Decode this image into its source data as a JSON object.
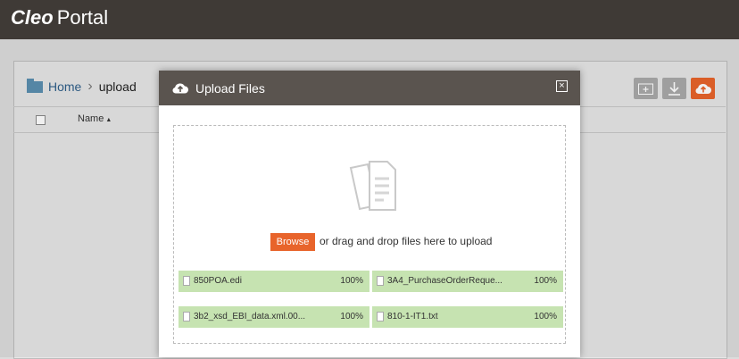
{
  "app": {
    "brand": "Cleo",
    "product": "Portal"
  },
  "breadcrumb": {
    "home": "Home",
    "current": "upload"
  },
  "table": {
    "name_header": "Name"
  },
  "toolbar": {
    "new_folder_icon": "folder-plus-icon",
    "download_icon": "download-icon",
    "upload_icon": "cloud-upload-icon",
    "upload_color": "#e8642b"
  },
  "modal": {
    "title": "Upload Files",
    "close_icon": "close-icon",
    "browse_label": "Browse",
    "drop_text": "or drag and drop files here to upload",
    "files": [
      {
        "name": "850POA.edi",
        "progress": "100%"
      },
      {
        "name": "3A4_PurchaseOrderReque...",
        "progress": "100%"
      },
      {
        "name": "3b2_xsd_EBI_data.xml.00...",
        "progress": "100%"
      },
      {
        "name": "810-1-IT1.txt",
        "progress": "100%"
      }
    ]
  }
}
